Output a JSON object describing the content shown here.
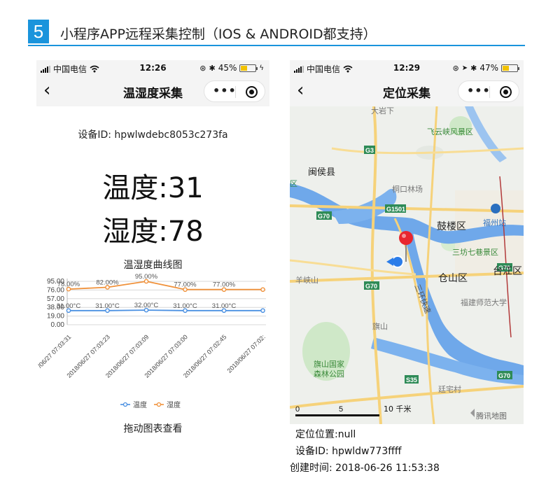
{
  "section": {
    "number": "5",
    "title": "小程序APP远程采集控制（IOS & ANDROID都支持）",
    "accent_color": "#1a94dc"
  },
  "left_phone": {
    "status": {
      "carrier": "中国电信",
      "time": "12:26",
      "battery": "45%",
      "battery_level": 0.45
    },
    "nav": {
      "back_icon": "chevron-left-icon",
      "title": "温湿度采集"
    },
    "device_id_line": "设备ID: hpwlwdebc8053c273fa",
    "temperature_line": "温度:31",
    "humidity_line": "湿度:78",
    "chart_title": "温湿度曲线图",
    "drag_hint": "拖动图表查看"
  },
  "chart_data": {
    "type": "line",
    "title": "温湿度曲线图",
    "categories": [
      "2018/06/27 07:03:31",
      "2018/06/27 07:03:23",
      "2018/06/27 07:03:09",
      "2018/06/27 07:03:00",
      "2018/06/27 07:02:45",
      "2018/06/27 07:02:"
    ],
    "category_labels": [
      "/06/27 07:03:31",
      "2018/06/27 07:03:23",
      "2018/06/27 07:03:09",
      "2018/06/27 07:03:00",
      "2018/06/27 07:02:45",
      "2018/06/27 07:02:",
      "2"
    ],
    "yticks": [
      "95.00",
      "76.00",
      "57.00",
      "38.00",
      "19.00",
      "0.00"
    ],
    "ylim": [
      0,
      95
    ],
    "grid": true,
    "legend_position": "bottom",
    "series": [
      {
        "name": "温度",
        "color": "#4a90e2",
        "values": [
          31,
          31,
          32,
          31,
          31,
          31
        ],
        "labels": [
          "31.00°C",
          "31.00°C",
          "32.00°C",
          "31.00°C",
          "31.00°C"
        ]
      },
      {
        "name": "湿度",
        "color": "#f0913a",
        "values": [
          78,
          82,
          95,
          77,
          77,
          77
        ],
        "labels": [
          "78.00%",
          "82.00%",
          "95.00%",
          "77.00%",
          "77.00%"
        ]
      }
    ]
  },
  "right_phone": {
    "status": {
      "carrier": "中国电信",
      "time": "12:29",
      "battery": "47%",
      "battery_level": 0.47
    },
    "nav": {
      "back_icon": "chevron-left-icon",
      "title": "定位采集"
    },
    "map": {
      "labels": {
        "dayanxia": "大岩下",
        "feiyunxia": "飞云峡风景区",
        "minhou": "闽侯县",
        "tonglou": "桐口林场",
        "gulou": "鼓楼区",
        "fuzhou_station": "福州站",
        "sanfang": "三坊七巷景区",
        "cangshan": "仓山区",
        "taijiang": "台江区",
        "yangxiashan": "羊峡山",
        "fjnu": "福建师范大学",
        "qishan": "旗山",
        "qishan_park_1": "旗山国家",
        "qishan_park_2": "森林公园",
        "tingzhai": "廷宅村",
        "sanhuan": "三环快速",
        "left_edge": "区"
      },
      "highways": [
        "G3",
        "G1501",
        "G70",
        "G70",
        "G70",
        "S35",
        "G70"
      ],
      "scale": [
        "0",
        "5",
        "10 千米"
      ],
      "provider": "腾讯地图"
    },
    "location_line": "定位位置:null",
    "device_line": "设备ID:  hpwldw773ffff",
    "created_line": "创建时间:  2018-06-26 11:53:38"
  }
}
